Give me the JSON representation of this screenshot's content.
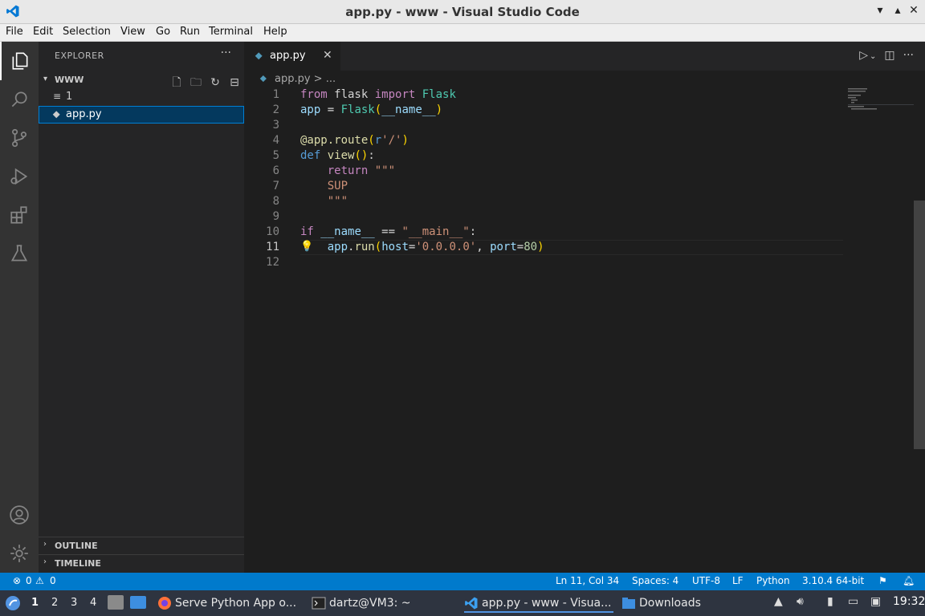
{
  "window": {
    "title": "app.py - www - Visual Studio Code",
    "controls": [
      "▾",
      "▴",
      "✕"
    ]
  },
  "menu": [
    "File",
    "Edit",
    "Selection",
    "View",
    "Go",
    "Run",
    "Terminal",
    "Help"
  ],
  "activity_bar": {
    "items": [
      "explorer-icon",
      "search-icon",
      "source-control-icon",
      "run-debug-icon",
      "extensions-icon",
      "testing-icon"
    ],
    "bottom": [
      "account-icon",
      "settings-icon"
    ]
  },
  "explorer": {
    "title": "EXPLORER",
    "more": "···",
    "folder": "WWW",
    "items": [
      {
        "label": "1",
        "icon": "≡"
      },
      {
        "label": "app.py",
        "icon": "⬥"
      }
    ],
    "outline": "OUTLINE",
    "timeline": "TIMELINE"
  },
  "tab": {
    "label": "app.py",
    "close": "✕"
  },
  "breadcrumb": "app.py > ...",
  "code": {
    "line_numbers": [
      "1",
      "2",
      "3",
      "4",
      "5",
      "6",
      "7",
      "8",
      "9",
      "10",
      "11",
      "12"
    ],
    "current_line": "11"
  },
  "status": {
    "errors": "0",
    "warnings": "0",
    "position": "Ln 11, Col 34",
    "spaces": "Spaces: 4",
    "encoding": "UTF-8",
    "eol": "LF",
    "language": "Python",
    "interpreter": "3.10.4 64-bit"
  },
  "taskbar": {
    "workspaces": [
      "1",
      "2",
      "3",
      "4"
    ],
    "tasks": [
      {
        "label": "Serve Python App o..."
      },
      {
        "label": "dartz@VM3: ~"
      },
      {
        "label": "app.py - www - Visua..."
      },
      {
        "label": "Downloads"
      }
    ],
    "clock": "19:32"
  }
}
